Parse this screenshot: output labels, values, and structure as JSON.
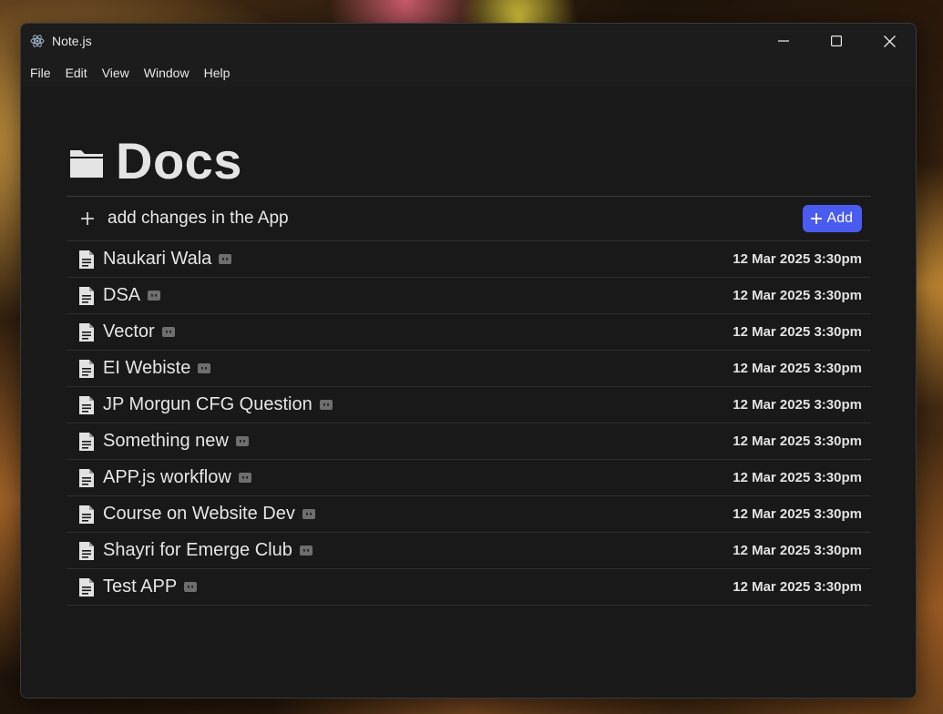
{
  "window": {
    "title": "Note.js"
  },
  "menu": [
    "File",
    "Edit",
    "View",
    "Window",
    "Help"
  ],
  "page": {
    "title": "Docs"
  },
  "new_doc": {
    "value": "add changes in the App",
    "add_label": "Add"
  },
  "docs": [
    {
      "name": "Naukari Wala",
      "date": "12 Mar 2025 3:30pm"
    },
    {
      "name": "DSA",
      "date": "12 Mar 2025 3:30pm"
    },
    {
      "name": "Vector",
      "date": "12 Mar 2025 3:30pm"
    },
    {
      "name": "EI Webiste",
      "date": "12 Mar 2025 3:30pm"
    },
    {
      "name": "JP Morgun CFG Question",
      "date": "12 Mar 2025 3:30pm"
    },
    {
      "name": "Something new",
      "date": "12 Mar 2025 3:30pm"
    },
    {
      "name": "APP.js workflow",
      "date": "12 Mar 2025 3:30pm"
    },
    {
      "name": "Course on Website Dev",
      "date": "12 Mar 2025 3:30pm"
    },
    {
      "name": "Shayri for Emerge Club",
      "date": "12 Mar 2025 3:30pm"
    },
    {
      "name": "Test APP",
      "date": "12 Mar 2025 3:30pm"
    }
  ],
  "colors": {
    "accent": "#4a5bf0",
    "background": "#191919",
    "text": "#e6e6e6"
  }
}
